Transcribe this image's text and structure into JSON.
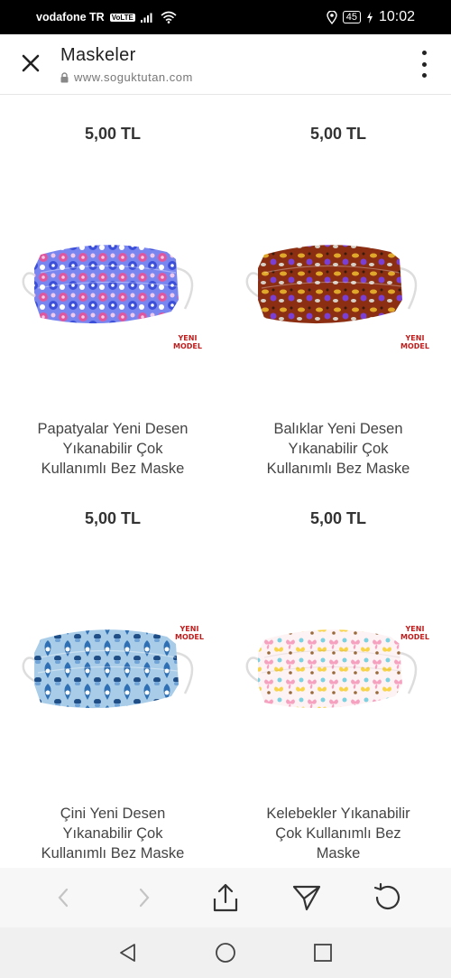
{
  "status_bar": {
    "carrier": "vodafone TR",
    "volte": "VoLTE",
    "battery": "45",
    "time": "10:02"
  },
  "header": {
    "title": "Maskeler",
    "url": "www.soguktutan.com"
  },
  "products_top": [
    {
      "price": "5,00 TL"
    },
    {
      "price": "5,00 TL"
    }
  ],
  "products": [
    {
      "name_lines": [
        "Papatyalar Yeni Desen",
        "Yıkanabilir Çok",
        "Kullanımlı Bez Maske"
      ],
      "price": "5,00 TL",
      "badge_line1": "YENI",
      "badge_line2": "MODEL",
      "pattern": "daisy"
    },
    {
      "name_lines": [
        "Balıklar Yeni Desen",
        "Yıkanabilir Çok",
        "Kullanımlı Bez Maske"
      ],
      "price": "5,00 TL",
      "badge_line1": "YENI",
      "badge_line2": "MODEL",
      "pattern": "fish"
    },
    {
      "name_lines": [
        "Çini Yeni Desen",
        "Yıkanabilir Çok",
        "Kullanımlı Bez Maske"
      ],
      "price": "",
      "badge_line1": "YENI",
      "badge_line2": "MODEL",
      "pattern": "tile"
    },
    {
      "name_lines": [
        "Kelebekler Yıkanabilir",
        "Çok Kullanımlı Bez",
        "Maske"
      ],
      "price": "",
      "badge_line1": "YENI",
      "badge_line2": "MODEL",
      "pattern": "butterfly"
    }
  ],
  "colors": {
    "badge": "#c21d1d",
    "daisy": [
      "#3b4fd8",
      "#e0569e",
      "#7a86f0",
      "#f2c9e6",
      "#ffffff"
    ],
    "fish": [
      "#8b2e12",
      "#e0a82a",
      "#7b3fd1",
      "#3a1a0c",
      "#d6d1c8"
    ],
    "tile": [
      "#2f6fb3",
      "#a9cde8",
      "#ffffff",
      "#1f4e86",
      "#6fa2d6"
    ],
    "butterfly": [
      "#f6a1c0",
      "#f7d44a",
      "#7ed1e0",
      "#9a6b3c",
      "#fdf3f4"
    ]
  },
  "icons": {
    "close": "close-icon",
    "lock": "lock-icon",
    "menu": "more-vertical-icon",
    "back": "chevron-left-icon",
    "forward": "chevron-right-icon",
    "share": "share-icon",
    "send": "send-icon",
    "reload": "reload-icon",
    "nav_back": "nav-back-icon",
    "nav_home": "nav-home-icon",
    "nav_recent": "nav-recent-icon"
  }
}
